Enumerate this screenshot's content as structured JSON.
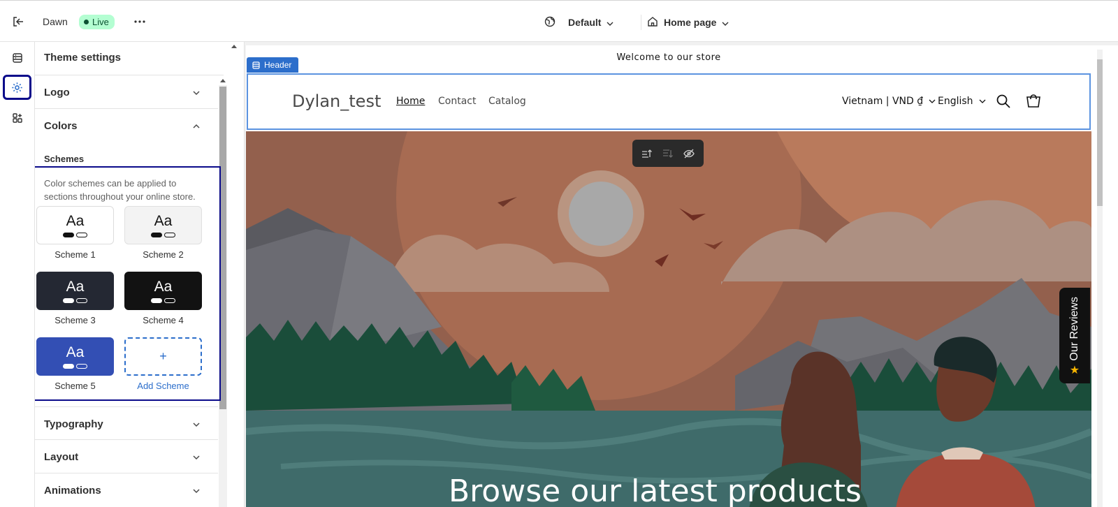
{
  "topbar": {
    "theme_name": "Dawn",
    "status": "Live",
    "theme_selector": "Default",
    "page_selector": "Home page"
  },
  "panel": {
    "title": "Theme settings",
    "sections": {
      "logo": "Logo",
      "colors": "Colors",
      "typography": "Typography",
      "layout": "Layout",
      "animations": "Animations"
    },
    "schemes": {
      "heading": "Schemes",
      "description": "Color schemes can be applied to sections throughout your online store.",
      "preview_text": "Aa",
      "items": [
        {
          "name": "Scheme 1",
          "bg": "#ffffff",
          "fg": "#121212"
        },
        {
          "name": "Scheme 2",
          "bg": "#f3f3f3",
          "fg": "#121212"
        },
        {
          "name": "Scheme 3",
          "bg": "#242833",
          "fg": "#ffffff"
        },
        {
          "name": "Scheme 4",
          "bg": "#121212",
          "fg": "#ffffff"
        },
        {
          "name": "Scheme 5",
          "bg": "#334fb4",
          "fg": "#ffffff"
        }
      ],
      "add_label": "Add Scheme",
      "add_symbol": "+"
    }
  },
  "preview": {
    "announcement": "Welcome to our store",
    "section_tag": "Header",
    "store_name": "Dylan_test",
    "nav": [
      "Home",
      "Contact",
      "Catalog"
    ],
    "country": "Vietnam | VND ₫",
    "language": "English",
    "hero_title": "Browse our latest products",
    "reviews_tab": "Our Reviews",
    "reviews_icon": "★"
  },
  "colors": {
    "accent": "#2c6ecb",
    "live_bg": "#b4fed2",
    "highlight": "#0a0a8a"
  }
}
